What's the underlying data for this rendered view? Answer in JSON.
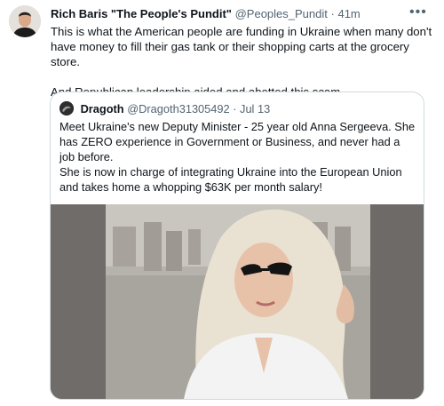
{
  "tweet": {
    "author_name": "Rich Baris \"The People's Pundit\"",
    "handle": "@Peoples_Pundit",
    "time": "41m",
    "separator": "·",
    "text_paragraphs": [
      "This is what the American people are funding in Ukraine when many don't have money to fill their gas tank or their shopping carts at the grocery store.",
      "And Republican leadership aided and abetted this scam."
    ],
    "more_icon": "more-horizontal-icon"
  },
  "quoted_tweet": {
    "author_name": "Dragoth",
    "handle": "@Dragoth31305492",
    "separator": "·",
    "time": "Jul 13",
    "text_lines": [
      "Meet Ukraine's new Deputy Minister - 25 year old Anna Sergeeva. She has ZERO experience in Government or Business, and never had a job before.",
      "She is now in charge of integrating Ukraine into the European Union and takes home a whopping $63K per month salary!"
    ]
  },
  "colors": {
    "text_primary": "#0f1419",
    "text_secondary": "#536471",
    "border": "#cfd9de"
  }
}
